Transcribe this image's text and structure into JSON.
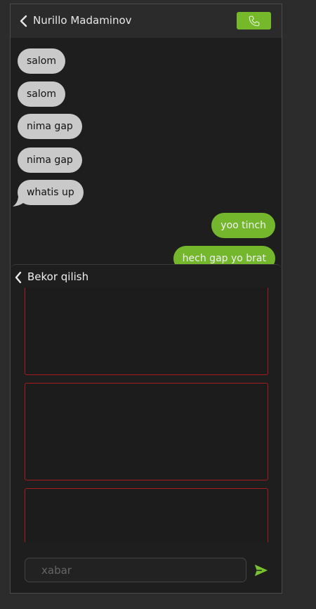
{
  "header": {
    "contact_name": "Nurillo Madaminov",
    "call_icon": "phone-icon",
    "accent_color": "#75b82a"
  },
  "messages": [
    {
      "text": "salom",
      "side": "in"
    },
    {
      "text": "salom",
      "side": "in"
    },
    {
      "text": "nima gap",
      "side": "in"
    },
    {
      "text": "nima gap",
      "side": "in"
    },
    {
      "text": "whatis up",
      "side": "in"
    },
    {
      "text": "yoo tinch",
      "side": "out"
    },
    {
      "text": "hech gap yo brat",
      "side": "out"
    }
  ],
  "panel": {
    "cancel_label": "Bekor qilish"
  },
  "composer": {
    "placeholder": "xabar",
    "send_icon": "send-icon"
  }
}
